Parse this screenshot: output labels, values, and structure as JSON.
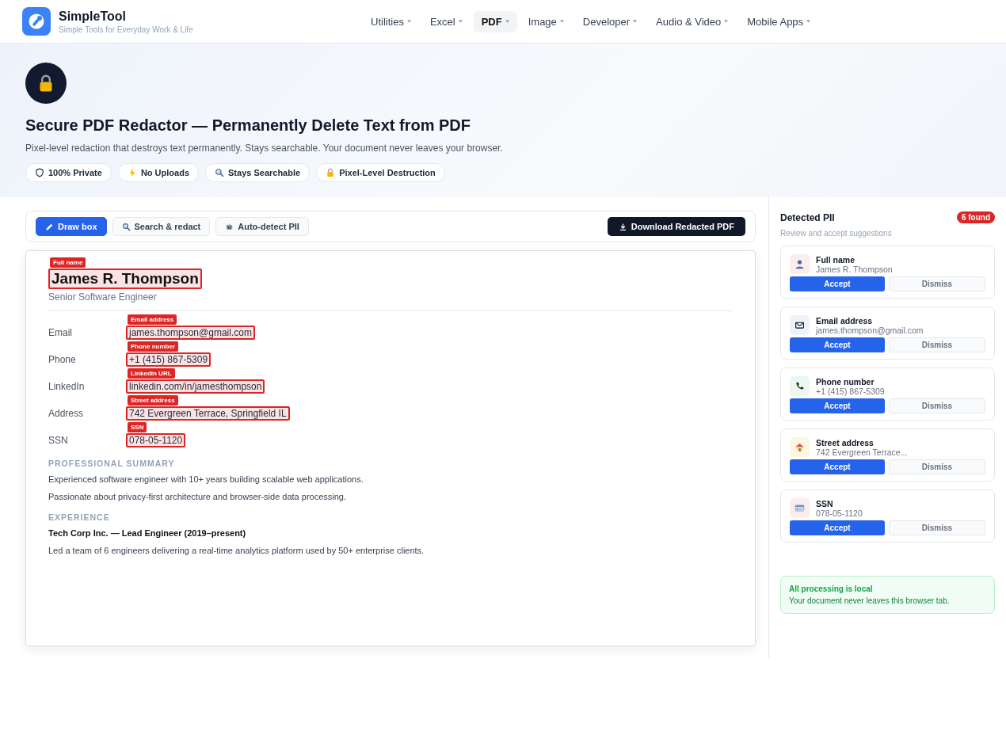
{
  "brand": {
    "name": "SimpleTool",
    "tagline": "Simple Tools for Everyday Work & Life"
  },
  "nav": [
    {
      "label": "Utilities",
      "selected": false
    },
    {
      "label": "Excel",
      "selected": false
    },
    {
      "label": "PDF",
      "selected": true
    },
    {
      "label": "Image",
      "selected": false
    },
    {
      "label": "Developer",
      "selected": false
    },
    {
      "label": "Audio & Video",
      "selected": false
    },
    {
      "label": "Mobile Apps",
      "selected": false
    }
  ],
  "hero": {
    "title": "Secure PDF Redactor — Permanently Delete Text from PDF",
    "subtitle": "Pixel-level redaction that destroys text permanently. Stays searchable. Your document never leaves your browser.",
    "chips": [
      {
        "kind": "shield",
        "label": "100% Private"
      },
      {
        "kind": "bolt",
        "label": "No Uploads"
      },
      {
        "kind": "search",
        "label": "Stays Searchable"
      },
      {
        "kind": "lock",
        "label": "Pixel-Level Destruction"
      }
    ]
  },
  "toolbar": {
    "tools": [
      {
        "kind": "pencil",
        "label": "Draw box",
        "selected": true
      },
      {
        "kind": "search",
        "label": "Search & redact",
        "selected": false
      },
      {
        "kind": "robot",
        "label": "Auto-detect PII",
        "selected": false
      }
    ],
    "download": "Download Redacted PDF"
  },
  "document": {
    "name": {
      "text": "James R. Thompson",
      "pii_label": "Full name"
    },
    "role": "Senior Software Engineer",
    "fields": [
      {
        "label": "Email",
        "value": "james.thompson@gmail.com",
        "pii_label": "Email address"
      },
      {
        "label": "Phone",
        "value": "+1 (415) 867-5309",
        "pii_label": "Phone number"
      },
      {
        "label": "LinkedIn",
        "value": "linkedin.com/in/jamesthompson",
        "pii_label": "LinkedIn URL"
      },
      {
        "label": "Address",
        "value": "742 Evergreen Terrace, Springfield IL",
        "pii_label": "Street address"
      },
      {
        "label": "SSN",
        "value": "078-05-1120",
        "pii_label": "SSN"
      }
    ],
    "sections": [
      {
        "heading": "PROFESSIONAL SUMMARY",
        "paragraphs": [
          {
            "text": "Experienced software engineer with 10+ years building scalable web applications.",
            "bold": false
          },
          {
            "text": "Passionate about privacy-first architecture and browser-side data processing.",
            "bold": false
          }
        ]
      },
      {
        "heading": "EXPERIENCE",
        "paragraphs": [
          {
            "text": "Tech Corp Inc. — Lead Engineer (2019–present)",
            "bold": true
          },
          {
            "text": "Led a team of 6 engineers delivering a real-time analytics platform used by 50+ enterprise clients.",
            "bold": false
          }
        ]
      }
    ]
  },
  "sidebar": {
    "title": "Detected PII",
    "count": "6 found",
    "subtitle": "Review and accept suggestions",
    "items": [
      {
        "kind": "person",
        "label": "Full name",
        "value": "James R. Thompson",
        "accept": "Accept",
        "dismiss": "Dismiss"
      },
      {
        "kind": "email",
        "label": "Email address",
        "value": "james.thompson@gmail.com",
        "accept": "Accept",
        "dismiss": "Dismiss"
      },
      {
        "kind": "phone",
        "label": "Phone number",
        "value": "+1 (415) 867-5309",
        "accept": "Accept",
        "dismiss": "Dismiss"
      },
      {
        "kind": "house",
        "label": "Street address",
        "value": "742 Evergreen Terrace...",
        "accept": "Accept",
        "dismiss": "Dismiss"
      },
      {
        "kind": "card",
        "label": "SSN",
        "value": "078-05-1120",
        "accept": "Accept",
        "dismiss": "Dismiss"
      }
    ],
    "notice": {
      "title": "All processing is local",
      "text": "Your document never leaves this browser tab."
    }
  }
}
